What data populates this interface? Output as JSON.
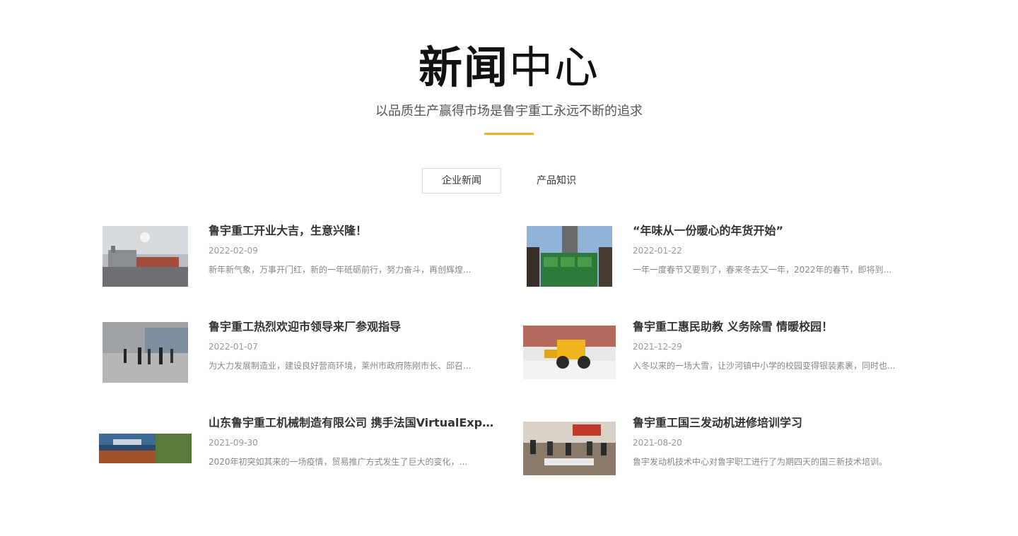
{
  "header": {
    "title_bold": "新闻",
    "title_light": "中心",
    "subtitle": "以品质生产赢得市场是鲁宇重工永远不断的追求",
    "accent_color": "#e8b122"
  },
  "tabs": [
    {
      "label": "企业新闻",
      "active": true
    },
    {
      "label": "产品知识",
      "active": false
    }
  ],
  "news": [
    {
      "title": "鲁宇重工开业大吉，生意兴隆！",
      "date": "2022-02-09",
      "summary": "新年新气象，万事开门红，新的一年砥砺前行，努力奋斗，再创辉煌..."
    },
    {
      "title": "“年味从一份暖心的年货开始”",
      "date": "2022-01-22",
      "summary": "一年一度春节又要到了，春来冬去又一年，2022年的春节，即将到来..."
    },
    {
      "title": "鲁宇重工热烈欢迎市领导来厂参观指导",
      "date": "2022-01-07",
      "summary": "为大力发展制造业，建设良好营商环境，莱州市政府陈刚市长、邱召..."
    },
    {
      "title": "鲁宇重工惠民助教 义务除雪 情暖校园！",
      "date": "2021-12-29",
      "summary": "入冬以来的一场大雪，让沙河镇中小学的校园变得银装素裹，同时也..."
    },
    {
      "title": "山东鲁宇重工机械制造有限公司 携手法国VirtualExpo...",
      "date": "2021-09-30",
      "summary": "2020年初突如其来的一场疫情，贸易推广方式发生了巨大的变化，以..."
    },
    {
      "title": "鲁宇重工国三发动机进修培训学习",
      "date": "2021-08-20",
      "summary": "鲁宇发动机技术中心对鲁宇职工进行了为期四天的国三新技术培训。"
    }
  ]
}
